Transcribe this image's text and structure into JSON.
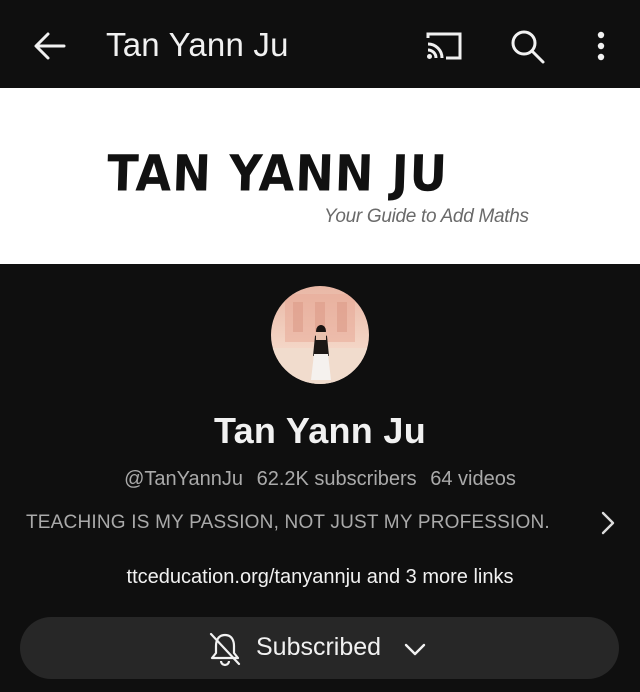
{
  "header": {
    "title": "Tan Yann Ju",
    "icons": [
      "back-arrow-icon",
      "cast-icon",
      "search-icon",
      "more-vert-icon"
    ]
  },
  "banner": {
    "brand": "TAN YANN JU",
    "tagline": "Your Guide to Add Maths"
  },
  "channel": {
    "name": "Tan Yann Ju",
    "handle": "@TanYannJu",
    "subscribers": "62.2K subscribers",
    "videos": "64 videos",
    "description": "TEACHING IS MY PASSION, NOT JUST MY PROFESSION.",
    "links": "ttceducation.org/tanyannju and 3 more links"
  },
  "subscribe_button": {
    "label": "Subscribed"
  },
  "colors": {
    "background": "#0f0f0f",
    "button_bg": "#272727",
    "primary_text": "#f1f1f1",
    "secondary_text": "#aaaaaa",
    "banner_bg": "#ffffff"
  }
}
